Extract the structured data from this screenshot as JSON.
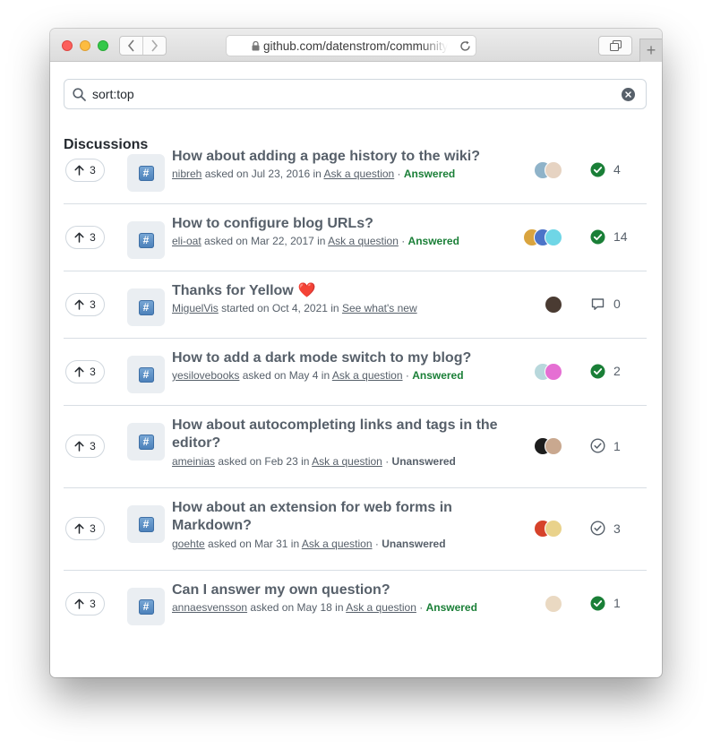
{
  "browser": {
    "url": "github.com/datenstrom/community",
    "back_icon": "chevron-left-icon",
    "forward_icon": "chevron-right-icon",
    "new_tab_label": "+"
  },
  "search": {
    "value": "sort:top"
  },
  "section_title": "Discussions",
  "colors": {
    "answered": "#1a7f37",
    "muted": "#57606a",
    "border": "#d0d7de"
  },
  "discussions": [
    {
      "upvotes": "3",
      "title": "How about adding a page history to the wiki?",
      "author": "nibreh",
      "verb": "asked on",
      "date": "Jul 23, 2016",
      "in_word": "in",
      "category": "Ask a question",
      "state": "Answered",
      "status_icon": "check-circle-filled-icon",
      "count": "4",
      "avatars": [
        "#8fb3c9",
        "#e6d3c2"
      ]
    },
    {
      "upvotes": "3",
      "title": "How to configure blog URLs?",
      "author": "eli-oat",
      "verb": "asked on",
      "date": "Mar 22, 2017",
      "in_word": "in",
      "category": "Ask a question",
      "state": "Answered",
      "status_icon": "check-circle-filled-icon",
      "count": "14",
      "avatars": [
        "#d9a43f",
        "#4c74c8",
        "#6fd6e6"
      ]
    },
    {
      "upvotes": "3",
      "title": "Thanks for Yellow",
      "emoji": "❤️",
      "author": "MiguelVis",
      "verb": "started on",
      "date": "Oct 4, 2021",
      "in_word": "in",
      "category": "See what's new",
      "state": "",
      "status_icon": "comment-icon",
      "count": "0",
      "avatars": [
        "#4a3b32"
      ]
    },
    {
      "upvotes": "3",
      "title": "How to add a dark mode switch to my blog?",
      "author": "yesilovebooks",
      "verb": "asked on",
      "date": "May 4",
      "in_word": "in",
      "category": "Ask a question",
      "state": "Answered",
      "status_icon": "check-circle-filled-icon",
      "count": "2",
      "avatars": [
        "#b8d8dc",
        "#e56fd3"
      ]
    },
    {
      "upvotes": "3",
      "title": "How about autocompleting links and tags in the editor?",
      "author": "ameinias",
      "verb": "asked on",
      "date": "Feb 23",
      "in_word": "in",
      "category": "Ask a question",
      "state": "Unanswered",
      "status_icon": "check-circle-outline-icon",
      "count": "1",
      "avatars": [
        "#1d1d1d",
        "#c9a88f"
      ]
    },
    {
      "upvotes": "3",
      "title": "How about an extension for web forms in Markdown?",
      "author": "goehte",
      "verb": "asked on",
      "date": "Mar 31",
      "in_word": "in",
      "category": "Ask a question",
      "state": "Unanswered",
      "status_icon": "check-circle-outline-icon",
      "count": "3",
      "avatars": [
        "#d6422a",
        "#e9d28b"
      ]
    },
    {
      "upvotes": "3",
      "title": "Can I answer my own question?",
      "author": "annaesvensson",
      "verb": "asked on",
      "date": "May 18",
      "in_word": "in",
      "category": "Ask a question",
      "state": "Answered",
      "status_icon": "check-circle-filled-icon",
      "count": "1",
      "avatars": [
        "#ead9c2"
      ]
    }
  ]
}
